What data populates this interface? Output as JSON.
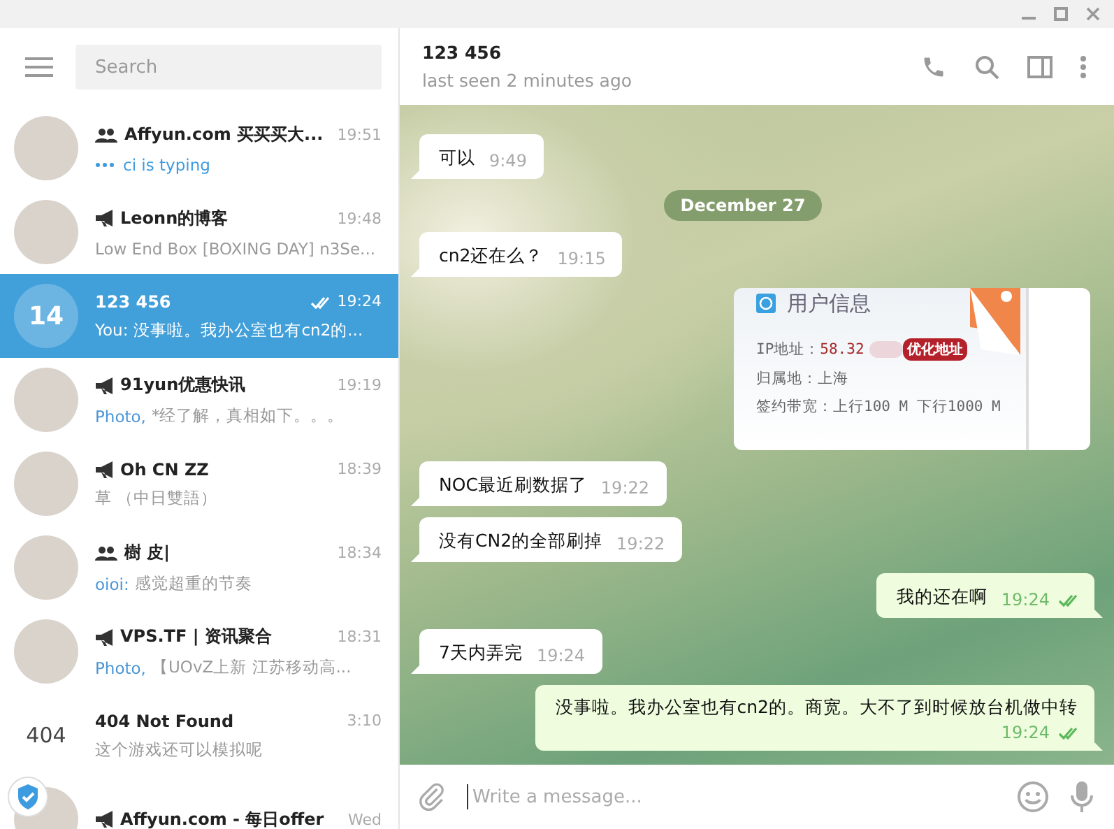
{
  "search": {
    "placeholder": "Search"
  },
  "chats": [
    {
      "kind": "group",
      "avatar": {
        "kind": "photo"
      },
      "title": "Affyun.com 买买买大...",
      "time": "19:51",
      "typing": true,
      "preview": "ci is typing",
      "selected": false
    },
    {
      "kind": "channel",
      "avatar": {
        "kind": "photo"
      },
      "title": "Leonn的博客",
      "time": "19:48",
      "preview": "Low End Box [BOXING DAY] n3Se...",
      "selected": false
    },
    {
      "kind": "user",
      "avatar": {
        "kind": "text",
        "text": "14"
      },
      "title": "123 456",
      "time": "19:24",
      "read": true,
      "prefix": "You:",
      "preview": "没事啦。我办公室也有cn2的...",
      "selected": true
    },
    {
      "kind": "channel",
      "avatar": {
        "kind": "photo"
      },
      "title": "91yun优惠快讯",
      "time": "19:19",
      "prefix": "Photo,",
      "preview": "*经了解，真相如下。。。",
      "selected": false
    },
    {
      "kind": "channel",
      "avatar": {
        "kind": "photo"
      },
      "title": "Oh CN ZZ",
      "time": "18:39",
      "preview": "草 （中日雙語）",
      "selected": false
    },
    {
      "kind": "group",
      "avatar": {
        "kind": "photo"
      },
      "title": "樹 皮|",
      "time": "18:34",
      "prefix": "oioi:",
      "preview": "感觉超重的节奏",
      "selected": false
    },
    {
      "kind": "channel",
      "avatar": {
        "kind": "photo"
      },
      "title": "VPS.TF | 资讯聚合",
      "time": "18:31",
      "prefix": "Photo,",
      "preview": "【UOvZ上新  江苏移动高...",
      "selected": false
    },
    {
      "kind": "user",
      "avatar": {
        "kind": "text",
        "text": "404"
      },
      "title": "404 Not Found",
      "time": "3:10",
      "preview": "这个游戏还可以模拟呢",
      "selected": false
    },
    {
      "kind": "channel",
      "avatar": {
        "kind": "photo"
      },
      "title": "Affyun.com - 每日offer",
      "time": "Wed",
      "selected": false
    }
  ],
  "chat": {
    "title": "123 456",
    "status": "last seen 2 minutes ago"
  },
  "messages": [
    {
      "kind": "incoming",
      "text": "可以",
      "time": "9:49"
    },
    {
      "kind": "date",
      "text": "December 27"
    },
    {
      "kind": "incoming",
      "text": "cn2还在么？",
      "time": "19:15"
    },
    {
      "kind": "image",
      "card": {
        "title": "用户信息",
        "badge": "优化地址",
        "rows": [
          {
            "label": "IP地址：",
            "value": "58.32",
            "redacted": true
          },
          {
            "label": "归属地：",
            "value": "上海"
          },
          {
            "label": "签约带宽：",
            "value": "上行100 M 下行1000 M"
          }
        ]
      }
    },
    {
      "kind": "incoming",
      "text": "NOC最近刷数据了",
      "time": "19:22"
    },
    {
      "kind": "incoming",
      "text": "没有CN2的全部刷掉",
      "time": "19:22"
    },
    {
      "kind": "outgoing",
      "text": "我的还在啊",
      "time": "19:24",
      "read": true
    },
    {
      "kind": "incoming",
      "text": "7天内弄完",
      "time": "19:24"
    },
    {
      "kind": "outgoing",
      "wide": true,
      "text": "没事啦。我办公室也有cn2的。商宽。大不了到时候放台机做中转",
      "time": "19:24",
      "read": true
    }
  ],
  "composer": {
    "placeholder": "Write a message..."
  }
}
